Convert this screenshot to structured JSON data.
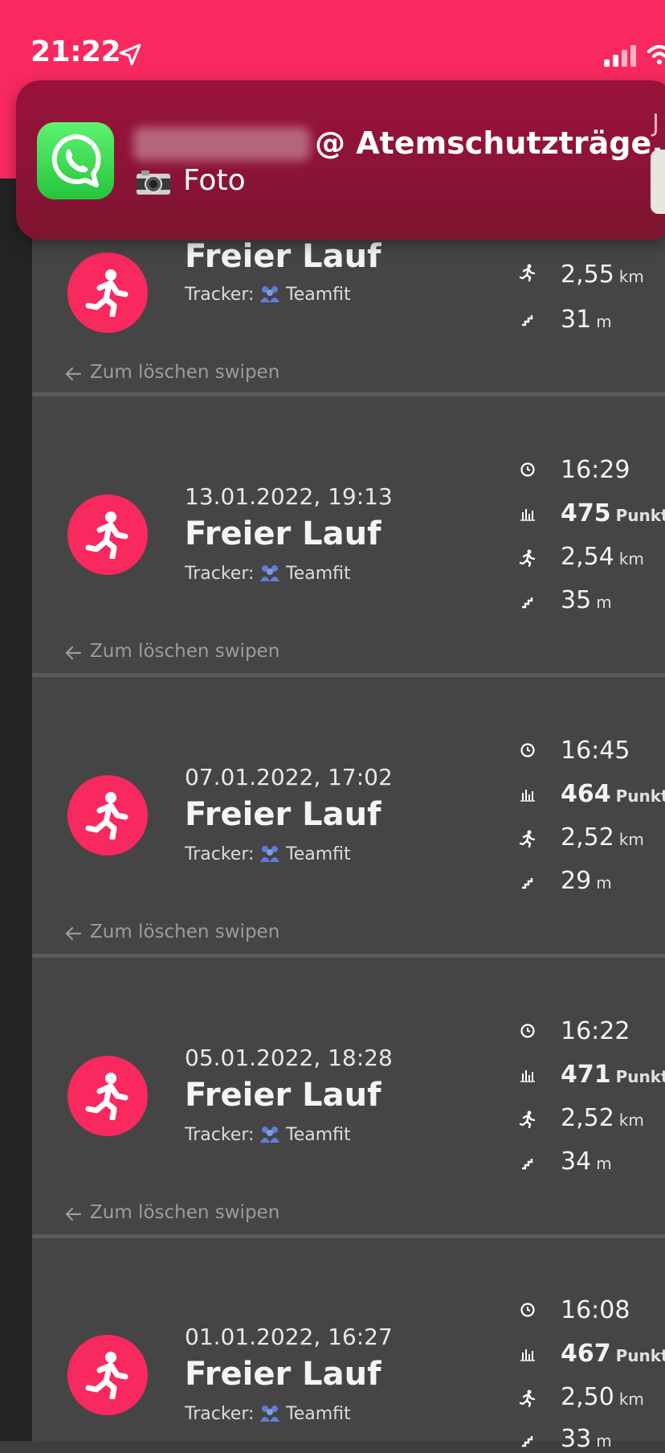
{
  "status": {
    "time": "21:22"
  },
  "notification": {
    "title": "@ Atemschutzträge...",
    "body": "Foto",
    "side_label": "J"
  },
  "colors": {
    "accent": "#f8295f",
    "card": "#454545",
    "tracker": "#5d7fd6"
  },
  "activities": [
    {
      "date": "",
      "title": "Freier Lauf",
      "tracker_label": "Tracker:",
      "tracker_name": "Teamfit",
      "duration": "",
      "points": "",
      "points_unit": "",
      "distance": "2,55",
      "distance_unit": "km",
      "elevation": "31",
      "elevation_unit": "m",
      "swipe_hint": "Zum löschen swipen"
    },
    {
      "date": "13.01.2022, 19:13",
      "title": "Freier Lauf",
      "tracker_label": "Tracker:",
      "tracker_name": "Teamfit",
      "duration": "16:29",
      "points": "475",
      "points_unit": "Punkte",
      "distance": "2,54",
      "distance_unit": "km",
      "elevation": "35",
      "elevation_unit": "m",
      "swipe_hint": "Zum löschen swipen"
    },
    {
      "date": "07.01.2022, 17:02",
      "title": "Freier Lauf",
      "tracker_label": "Tracker:",
      "tracker_name": "Teamfit",
      "duration": "16:45",
      "points": "464",
      "points_unit": "Punkte",
      "distance": "2,52",
      "distance_unit": "km",
      "elevation": "29",
      "elevation_unit": "m",
      "swipe_hint": "Zum löschen swipen"
    },
    {
      "date": "05.01.2022, 18:28",
      "title": "Freier Lauf",
      "tracker_label": "Tracker:",
      "tracker_name": "Teamfit",
      "duration": "16:22",
      "points": "471",
      "points_unit": "Punkte",
      "distance": "2,52",
      "distance_unit": "km",
      "elevation": "34",
      "elevation_unit": "m",
      "swipe_hint": "Zum löschen swipen"
    },
    {
      "date": "01.01.2022, 16:27",
      "title": "Freier Lauf",
      "tracker_label": "Tracker:",
      "tracker_name": "Teamfit",
      "duration": "16:08",
      "points": "467",
      "points_unit": "Punkte",
      "distance": "2,50",
      "distance_unit": "km",
      "elevation": "33",
      "elevation_unit": "m",
      "swipe_hint": ""
    }
  ],
  "icons": {
    "status": [
      "location-arrow-icon",
      "signal-icon",
      "wifi-icon"
    ],
    "row": [
      "running-person-icon",
      "team-icon",
      "clock-icon",
      "chart-bars-icon",
      "runner-icon",
      "stairs-icon",
      "arrow-left-icon"
    ]
  }
}
